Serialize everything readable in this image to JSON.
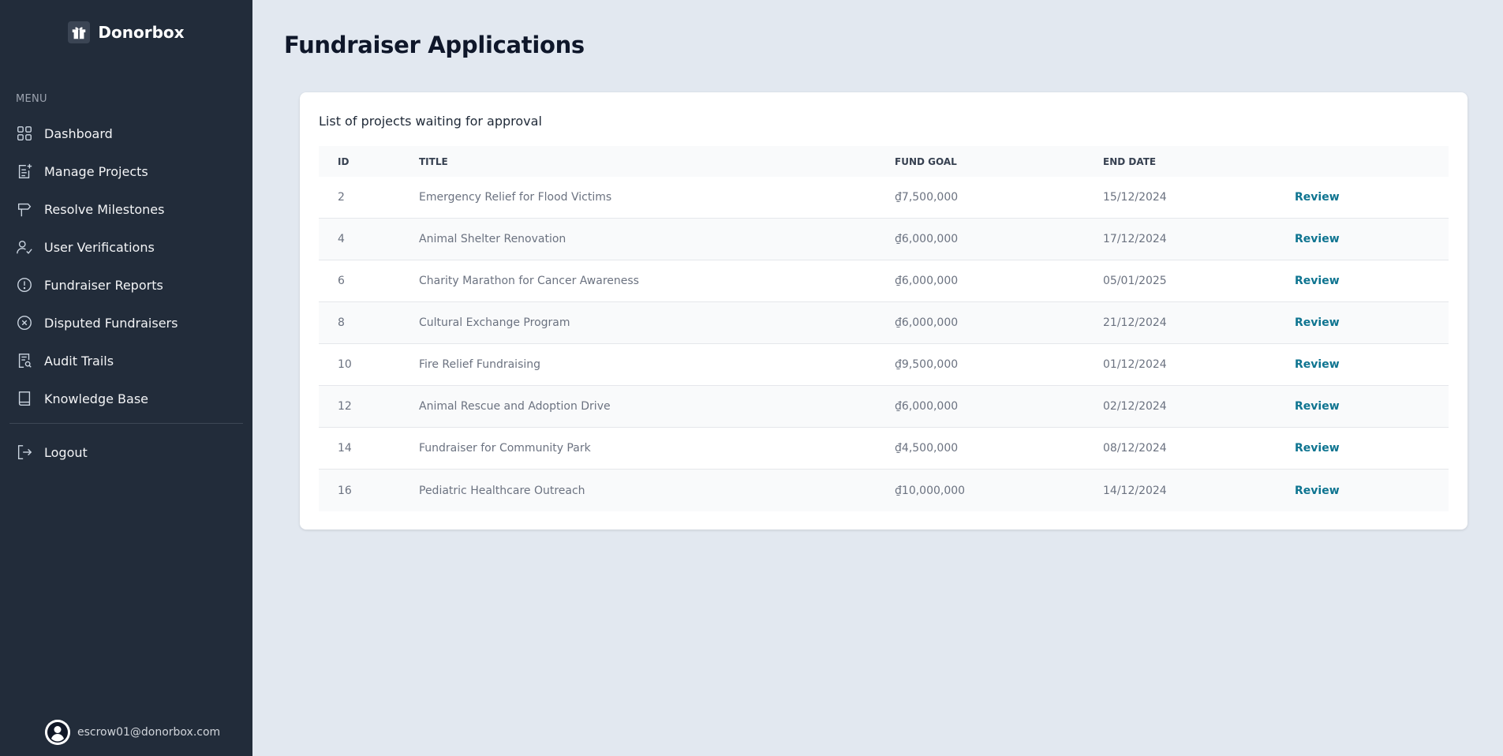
{
  "brand": {
    "name": "Donorbox",
    "icon": "gift-icon"
  },
  "sidebar": {
    "menu_heading": "MENU",
    "items": [
      {
        "label": "Dashboard",
        "icon": "grid-icon"
      },
      {
        "label": "Manage Projects",
        "icon": "document-plus-icon"
      },
      {
        "label": "Resolve Milestones",
        "icon": "signpost-icon"
      },
      {
        "label": "User Verifications",
        "icon": "user-check-icon"
      },
      {
        "label": "Fundraiser Reports",
        "icon": "alert-circle-icon"
      },
      {
        "label": "Disputed Fundraisers",
        "icon": "x-circle-icon"
      },
      {
        "label": "Audit Trails",
        "icon": "receipt-search-icon"
      },
      {
        "label": "Knowledge Base",
        "icon": "book-icon"
      }
    ],
    "logout": {
      "label": "Logout",
      "icon": "logout-icon"
    },
    "user": {
      "email": "escrow01@donorbox.com",
      "icon": "user-avatar-icon"
    }
  },
  "page": {
    "title": "Fundraiser Applications",
    "subtitle": "List of projects waiting for approval"
  },
  "table": {
    "headers": {
      "id": "ID",
      "title": "TITLE",
      "fund_goal": "FUND GOAL",
      "end_date": "END DATE"
    },
    "rows": [
      {
        "id": "2",
        "title": "Emergency Relief for Flood Victims",
        "fund_goal": "₫7,500,000",
        "end_date": "15/12/2024",
        "action": "Review"
      },
      {
        "id": "4",
        "title": "Animal Shelter Renovation",
        "fund_goal": "₫6,000,000",
        "end_date": "17/12/2024",
        "action": "Review"
      },
      {
        "id": "6",
        "title": "Charity Marathon for Cancer Awareness",
        "fund_goal": "₫6,000,000",
        "end_date": "05/01/2025",
        "action": "Review"
      },
      {
        "id": "8",
        "title": "Cultural Exchange Program",
        "fund_goal": "₫6,000,000",
        "end_date": "21/12/2024",
        "action": "Review"
      },
      {
        "id": "10",
        "title": "Fire Relief Fundraising",
        "fund_goal": "₫9,500,000",
        "end_date": "01/12/2024",
        "action": "Review"
      },
      {
        "id": "12",
        "title": "Animal Rescue and Adoption Drive",
        "fund_goal": "₫6,000,000",
        "end_date": "02/12/2024",
        "action": "Review"
      },
      {
        "id": "14",
        "title": "Fundraiser for Community Park",
        "fund_goal": "₫4,500,000",
        "end_date": "08/12/2024",
        "action": "Review"
      },
      {
        "id": "16",
        "title": "Pediatric Healthcare Outreach",
        "fund_goal": "₫10,000,000",
        "end_date": "14/12/2024",
        "action": "Review"
      }
    ]
  },
  "colors": {
    "sidebar_bg": "#222c3a",
    "page_bg": "#e2e8f0",
    "link": "#0e7490"
  }
}
